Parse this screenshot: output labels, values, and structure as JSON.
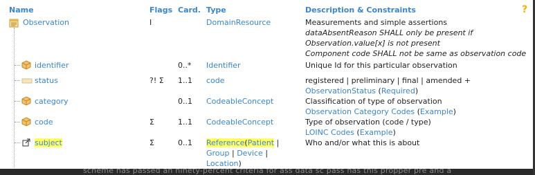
{
  "header": {
    "name": "Name",
    "flags": "Flags",
    "card": "Card.",
    "type": "Type",
    "desc": "Description & Constraints",
    "help": "?"
  },
  "rows": {
    "observation": {
      "name": "Observation",
      "flags": "I",
      "card": "",
      "type": "DomainResource",
      "desc1": "Measurements and simple assertions",
      "desc2": "dataAbsentReason SHALL only be present if",
      "desc3": "Observation.value[x] is not present",
      "desc4": "Component code SHALL not be same as observation code"
    },
    "identifier": {
      "name": "identifier",
      "flags": "",
      "card": "0..*",
      "type": "Identifier",
      "desc1": "Unique Id for this particular observation"
    },
    "status": {
      "name": "status",
      "flags": "?! Σ",
      "card": "1..1",
      "type": "code",
      "desc1": "registered | preliminary | final | amended +",
      "desc2_link": "ObservationStatus",
      "desc2_open": " (",
      "desc2_binding": "Required",
      "desc2_close": ")"
    },
    "category": {
      "name": "category",
      "flags": "",
      "card": "0..1",
      "type": "CodeableConcept",
      "desc1": "Classification of type of observation",
      "desc2_link": "Observation Category Codes",
      "desc2_open": " (",
      "desc2_binding": "Example",
      "desc2_close": ")"
    },
    "code": {
      "name": "code",
      "flags": "Σ",
      "card": "1..1",
      "type": "CodeableConcept",
      "desc1": "Type of observation (code / type)",
      "desc2_link": "LOINC Codes",
      "desc2_open": " (",
      "desc2_binding": "Example",
      "desc2_close": ")"
    },
    "subject": {
      "name": "subject",
      "flags": "Σ",
      "card": "0..1",
      "type_ref": "Reference",
      "type_open": "(",
      "type_patient": "Patient",
      "type_sep": " |",
      "type_group": "Group",
      "type_sep2": " | ",
      "type_device": "Device",
      "type_sep3": " |",
      "type_location": "Location",
      "type_close": ")",
      "desc1": "Who and/or what this is about"
    }
  },
  "background_fragment": "scheme nas passed an ninety-percent criteria for ass data sc pass has this propper pre and a",
  "colors": {
    "link": "#3a86c9",
    "highlight": "#ffff66",
    "header": "#3a86c9"
  }
}
